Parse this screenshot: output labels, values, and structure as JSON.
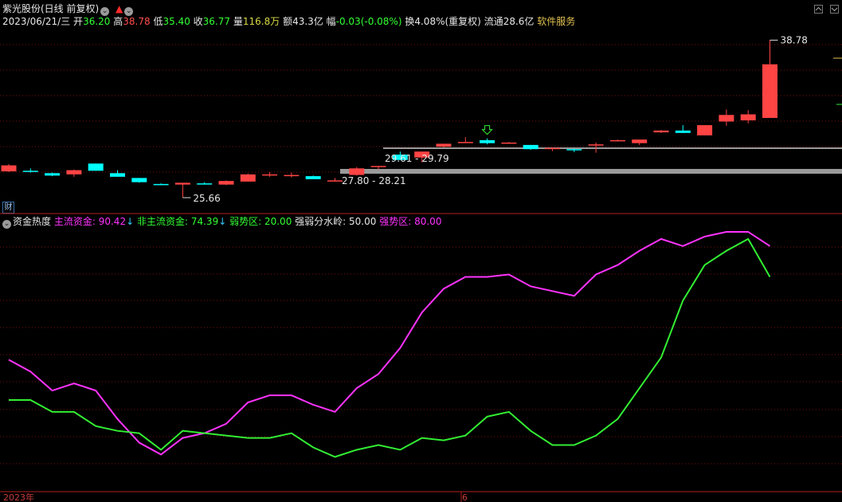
{
  "header": {
    "stock_name": "紫光股份(日线 前复权)",
    "date": "2023/06/21/三",
    "open_label": "开",
    "open_value": "36.20",
    "high_label": "高",
    "high_value": "38.78",
    "low_label": "低",
    "low_value": "35.40",
    "close_label": "收",
    "close_value": "36.77",
    "volume_label": "量",
    "volume_value": "116.8万",
    "amount_label": "额",
    "amount_value": "43.3亿",
    "change_label": "幅",
    "change_value": "-0.03(-0.08%)",
    "turnover": "换4.08%(重复权)",
    "float_cap": "流通28.6亿",
    "service": "软件服务"
  },
  "annotations": {
    "high_price": "38.78",
    "low_price": "25.66",
    "zone_upper": "29.61 - 29.79",
    "zone_lower": "27.80 - 28.21"
  },
  "indicator": {
    "name": "资金热度",
    "main_label": "主流资金:",
    "main_value": "90.42",
    "non_main_label": "非主流资金:",
    "non_main_value": "74.39",
    "weak_label": "弱势区:",
    "weak_value": "20.00",
    "divide_label": "强弱分水岭:",
    "divide_value": "50.00",
    "strong_label": "强势区:",
    "strong_value": "80.00"
  },
  "badge": "财",
  "axis": {
    "year_label": "2023年",
    "month_label": "6"
  },
  "colors": {
    "up": "#ff4444",
    "down": "#00ffff",
    "main_line": "#ff33ff",
    "non_main_line": "#33ee33",
    "grid": "#7a1010",
    "zone": "#9a9a9a"
  },
  "chart_data": {
    "type": "candlestick",
    "price_range": [
      25.0,
      40.0
    ],
    "candles": [
      {
        "o": 27.85,
        "h": 28.45,
        "l": 27.8,
        "c": 28.35
      },
      {
        "o": 27.9,
        "h": 28.1,
        "l": 27.75,
        "c": 27.8
      },
      {
        "o": 27.7,
        "h": 27.75,
        "l": 27.45,
        "c": 27.5
      },
      {
        "o": 27.6,
        "h": 28.0,
        "l": 27.4,
        "c": 27.95
      },
      {
        "o": 28.5,
        "h": 28.5,
        "l": 27.9,
        "c": 27.9
      },
      {
        "o": 27.7,
        "h": 27.95,
        "l": 27.4,
        "c": 27.4
      },
      {
        "o": 27.3,
        "h": 27.3,
        "l": 26.9,
        "c": 26.95
      },
      {
        "o": 26.8,
        "h": 26.85,
        "l": 26.7,
        "c": 26.75
      },
      {
        "o": 26.75,
        "h": 26.9,
        "l": 25.66,
        "c": 26.9
      },
      {
        "o": 26.85,
        "h": 26.95,
        "l": 26.75,
        "c": 26.8
      },
      {
        "o": 26.75,
        "h": 27.1,
        "l": 26.7,
        "c": 27.05
      },
      {
        "o": 27.0,
        "h": 27.65,
        "l": 27.0,
        "c": 27.6
      },
      {
        "o": 27.6,
        "h": 27.8,
        "l": 27.4,
        "c": 27.6
      },
      {
        "o": 27.55,
        "h": 27.75,
        "l": 27.35,
        "c": 27.55
      },
      {
        "o": 27.45,
        "h": 27.5,
        "l": 27.2,
        "c": 27.2
      },
      {
        "o": 27.1,
        "h": 27.3,
        "l": 27.0,
        "c": 27.1
      },
      {
        "o": 27.55,
        "h": 28.21,
        "l": 27.5,
        "c": 28.1
      },
      {
        "o": 28.2,
        "h": 28.3,
        "l": 28.0,
        "c": 28.3
      },
      {
        "o": 29.25,
        "h": 29.5,
        "l": 28.8,
        "c": 28.8
      },
      {
        "o": 29.0,
        "h": 29.5,
        "l": 28.6,
        "c": 29.5
      },
      {
        "o": 29.9,
        "h": 30.15,
        "l": 29.85,
        "c": 30.15
      },
      {
        "o": 30.3,
        "h": 30.7,
        "l": 30.3,
        "c": 30.3
      },
      {
        "o": 30.45,
        "h": 30.6,
        "l": 30.1,
        "c": 30.2
      },
      {
        "o": 30.25,
        "h": 30.3,
        "l": 30.15,
        "c": 30.25
      },
      {
        "o": 30.05,
        "h": 30.05,
        "l": 29.65,
        "c": 29.7
      },
      {
        "o": 29.8,
        "h": 29.85,
        "l": 29.55,
        "c": 29.8
      },
      {
        "o": 29.7,
        "h": 29.75,
        "l": 29.45,
        "c": 29.65
      },
      {
        "o": 30.1,
        "h": 30.25,
        "l": 29.4,
        "c": 30.1
      },
      {
        "o": 30.45,
        "h": 30.5,
        "l": 30.35,
        "c": 30.45
      },
      {
        "o": 30.2,
        "h": 30.4,
        "l": 30.05,
        "c": 30.5
      },
      {
        "o": 31.1,
        "h": 31.3,
        "l": 31.05,
        "c": 31.25
      },
      {
        "o": 31.25,
        "h": 31.7,
        "l": 31.05,
        "c": 31.05
      },
      {
        "o": 30.85,
        "h": 31.7,
        "l": 30.85,
        "c": 31.7
      },
      {
        "o": 32.0,
        "h": 33.0,
        "l": 31.65,
        "c": 32.55
      },
      {
        "o": 32.1,
        "h": 32.95,
        "l": 31.85,
        "c": 32.6
      },
      {
        "o": 32.3,
        "h": 38.78,
        "l": 35.4,
        "c": 36.77
      }
    ],
    "main_fund": [
      55,
      50,
      42,
      45,
      42,
      30,
      20,
      15,
      22,
      24,
      28,
      37,
      40,
      40,
      36,
      33,
      43,
      49,
      60,
      75,
      85,
      90,
      90,
      91,
      86,
      84,
      82,
      91,
      95,
      101,
      106,
      103,
      107,
      109,
      109,
      103
    ],
    "non_main_fund": [
      38,
      38,
      33,
      33,
      27,
      25,
      24,
      17,
      25,
      24,
      23,
      22,
      22,
      24,
      18,
      14,
      17,
      19,
      17,
      22,
      21,
      23,
      31,
      33,
      25,
      19,
      19,
      23,
      30,
      43,
      56,
      80,
      95,
      101,
      106,
      90
    ],
    "indicator_range": [
      0,
      110
    ]
  }
}
